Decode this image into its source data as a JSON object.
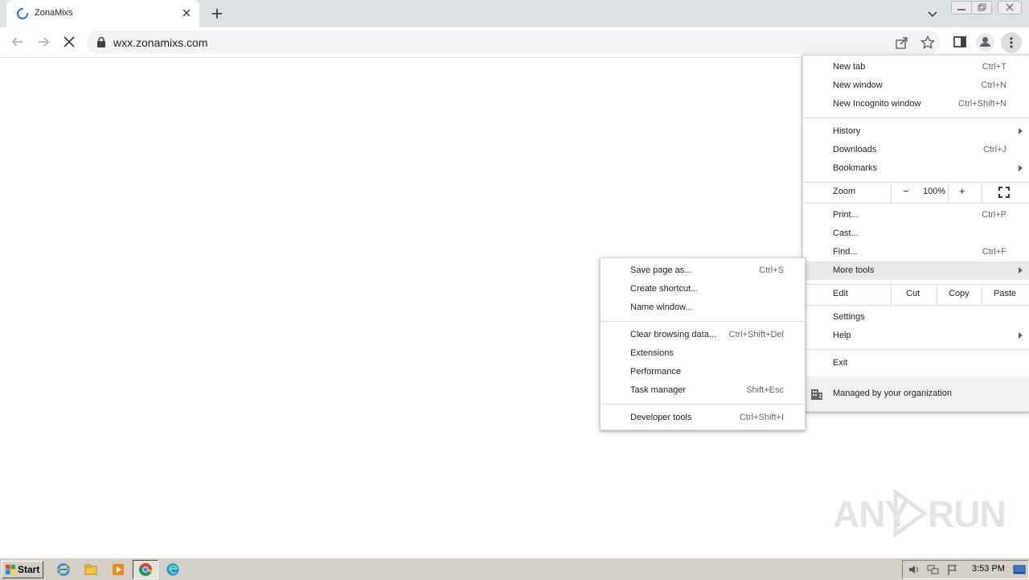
{
  "tab": {
    "title": "ZonaMixs"
  },
  "omnibox": {
    "url": "wxx.zonamixs.com"
  },
  "main_menu": {
    "new_tab": {
      "label": "New tab",
      "shortcut": "Ctrl+T"
    },
    "new_window": {
      "label": "New window",
      "shortcut": "Ctrl+N"
    },
    "new_incognito": {
      "label": "New Incognito window",
      "shortcut": "Ctrl+Shift+N"
    },
    "history": {
      "label": "History"
    },
    "downloads": {
      "label": "Downloads",
      "shortcut": "Ctrl+J"
    },
    "bookmarks": {
      "label": "Bookmarks"
    },
    "zoom": {
      "label": "Zoom",
      "minus": "−",
      "value": "100%",
      "plus": "+"
    },
    "print": {
      "label": "Print...",
      "shortcut": "Ctrl+P"
    },
    "cast": {
      "label": "Cast..."
    },
    "find": {
      "label": "Find...",
      "shortcut": "Ctrl+F"
    },
    "more_tools": {
      "label": "More tools"
    },
    "edit": {
      "label": "Edit",
      "cut": "Cut",
      "copy": "Copy",
      "paste": "Paste"
    },
    "settings": {
      "label": "Settings"
    },
    "help": {
      "label": "Help"
    },
    "exit": {
      "label": "Exit"
    },
    "managed": {
      "label": "Managed by your organization"
    }
  },
  "sub_menu": {
    "save_page": {
      "label": "Save page as...",
      "shortcut": "Ctrl+S"
    },
    "create_shortcut": {
      "label": "Create shortcut..."
    },
    "name_window": {
      "label": "Name window..."
    },
    "clear_data": {
      "label": "Clear browsing data...",
      "shortcut": "Ctrl+Shift+Del"
    },
    "extensions": {
      "label": "Extensions"
    },
    "performance": {
      "label": "Performance"
    },
    "task_manager": {
      "label": "Task manager",
      "shortcut": "Shift+Esc"
    },
    "dev_tools": {
      "label": "Developer tools",
      "shortcut": "Ctrl+Shift+I"
    }
  },
  "watermark": {
    "left": "ANY",
    "right": "RUN"
  },
  "taskbar": {
    "start": "Start",
    "clock": "3:53 PM"
  },
  "colors": {
    "accent": "#1a73e8",
    "tabstrip": "#dee1e6",
    "taskbar": "#d4d0c8"
  }
}
